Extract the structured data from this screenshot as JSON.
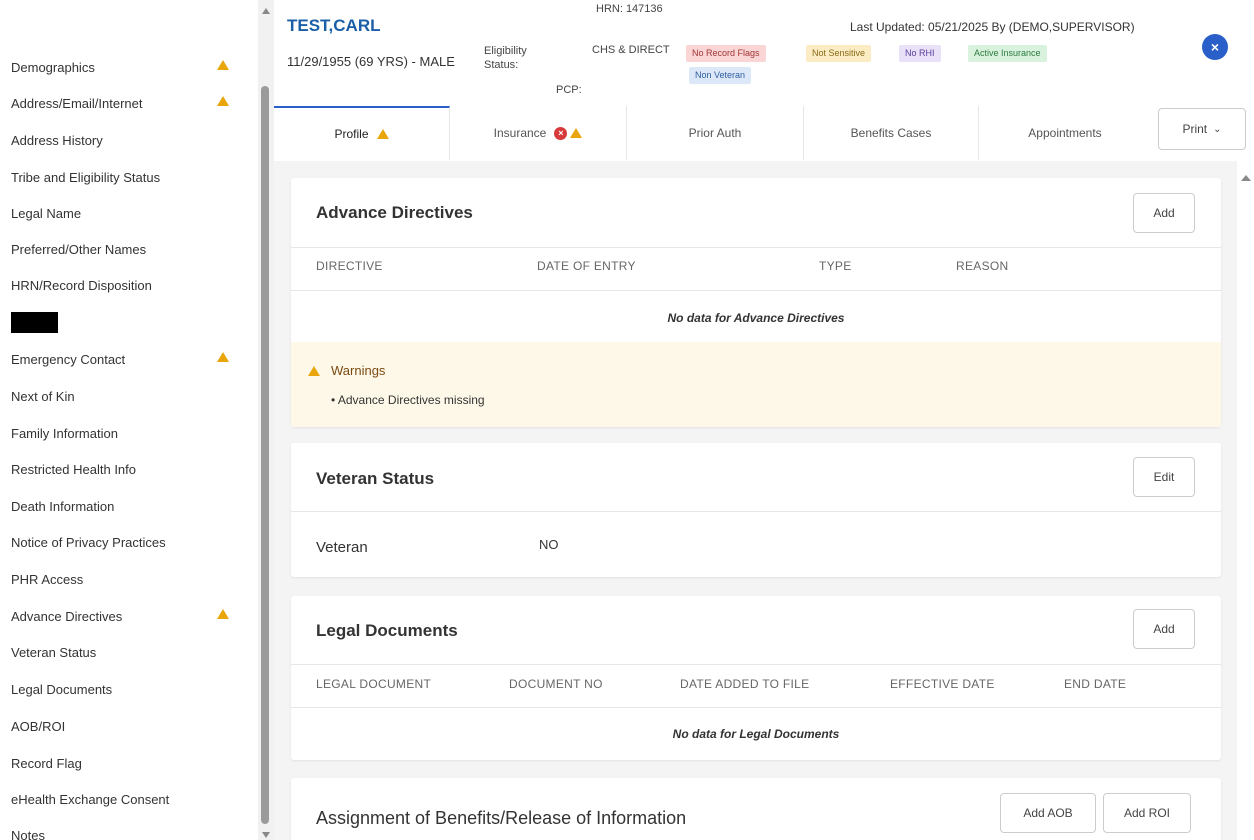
{
  "sidebar": {
    "items": [
      {
        "label": "Demographics",
        "warn": true
      },
      {
        "label": "Address/Email/Internet",
        "warn": true
      },
      {
        "label": "Address History",
        "warn": false
      },
      {
        "label": "Tribe and Eligibility Status",
        "warn": false
      },
      {
        "label": "Legal Name",
        "warn": false
      },
      {
        "label": "Preferred/Other Names",
        "warn": false
      },
      {
        "label": "HRN/Record Disposition",
        "warn": false
      },
      {
        "label": "Emergency Contact",
        "warn": true
      },
      {
        "label": "Next of Kin",
        "warn": false
      },
      {
        "label": "Family Information",
        "warn": false
      },
      {
        "label": "Restricted Health Info",
        "warn": false
      },
      {
        "label": "Death Information",
        "warn": false
      },
      {
        "label": "Notice of Privacy Practices",
        "warn": false
      },
      {
        "label": "PHR Access",
        "warn": false
      },
      {
        "label": "Advance Directives",
        "warn": true
      },
      {
        "label": "Veteran Status",
        "warn": false
      },
      {
        "label": "Legal Documents",
        "warn": false
      },
      {
        "label": "AOB/ROI",
        "warn": false
      },
      {
        "label": "Record Flag",
        "warn": false
      },
      {
        "label": "eHealth Exchange Consent",
        "warn": false
      },
      {
        "label": "Notes",
        "warn": false
      }
    ]
  },
  "header": {
    "name": "TEST,CARL",
    "dob": "11/29/1955 (69 YRS) - MALE",
    "hrn": "HRN: 147136",
    "eligibility_label": "Eligibility Status:",
    "eligibility_value": "CHS & DIRECT",
    "pcp": "PCP:",
    "last_updated": "Last Updated: 05/21/2025 By (DEMO,SUPERVISOR)",
    "badges": {
      "flags": "No Record Flags",
      "sensitive": "Not Sensitive",
      "rhi": "No RHI",
      "insurance": "Active Insurance",
      "veteran": "Non Veteran"
    },
    "close": "×"
  },
  "tabs": {
    "profile": "Profile",
    "insurance": "Insurance",
    "prior_auth": "Prior Auth",
    "benefits": "Benefits Cases",
    "appointments": "Appointments",
    "print": "Print",
    "print_chevron": "⌄"
  },
  "advance_directives": {
    "title": "Advance Directives",
    "add": "Add",
    "columns": [
      "DIRECTIVE",
      "DATE OF ENTRY",
      "TYPE",
      "REASON"
    ],
    "nodata": "No data for Advance Directives",
    "warnings_title": "Warnings",
    "warning_item": "•  Advance Directives missing"
  },
  "veteran_status": {
    "title": "Veteran Status",
    "edit": "Edit",
    "label": "Veteran",
    "value": "NO"
  },
  "legal_documents": {
    "title": "Legal Documents",
    "add": "Add",
    "columns": [
      "LEGAL DOCUMENT",
      "DOCUMENT NO",
      "DATE ADDED TO FILE",
      "EFFECTIVE DATE",
      "END DATE"
    ],
    "nodata": "No data for Legal Documents"
  },
  "aob_roi": {
    "title": "Assignment of Benefits/Release of Information",
    "add_aob": "Add AOB",
    "add_roi": "Add ROI"
  },
  "colors": {
    "accent": "#2a5fc9",
    "name": "#1b5fa8",
    "warning": "#e8a60c",
    "error": "#d63a3a"
  }
}
